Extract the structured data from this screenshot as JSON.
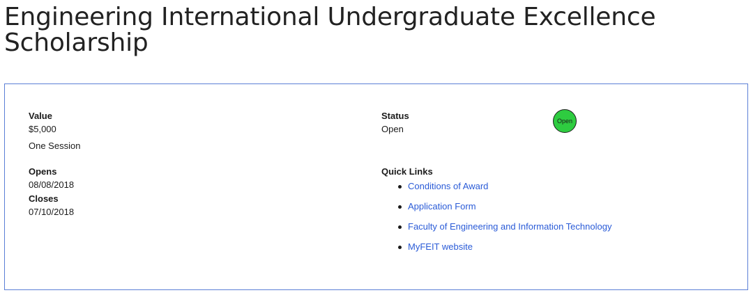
{
  "page": {
    "title": "Engineering International Undergraduate Excellence Scholarship"
  },
  "details": {
    "value_label": "Value",
    "value_amount": "$5,000",
    "value_period": "One Session",
    "opens_label": "Opens",
    "opens_date": "08/08/2018",
    "closes_label": "Closes",
    "closes_date": "07/10/2018",
    "status_label": "Status",
    "status_value": "Open",
    "status_badge": "Open",
    "status_color": "#2ecc40",
    "quick_links_label": "Quick Links",
    "quick_links": [
      {
        "label": "Conditions of Award"
      },
      {
        "label": "Application Form"
      },
      {
        "label": "Faculty of Engineering and Information Technology"
      },
      {
        "label": "MyFEIT website"
      }
    ]
  },
  "colors": {
    "link": "#2a5bd7",
    "box_border": "#5b7fd6"
  }
}
